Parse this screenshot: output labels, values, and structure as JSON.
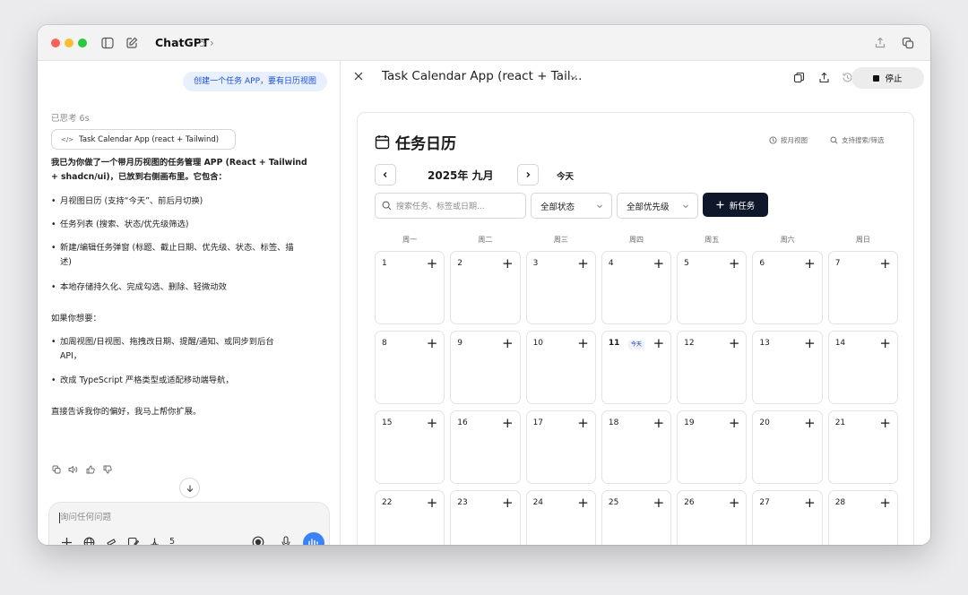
{
  "app": {
    "title": "ChatGPT",
    "version": "5"
  },
  "chat": {
    "user_message": "创建一个任务 APP，要有日历视图",
    "thought_label": "已思考 6s",
    "file_chip": {
      "icon": "</>",
      "name": "Task Calendar App (react + Tailwind)"
    },
    "intro_line1": "我已为你做了一个带月历视图的任务管理 APP (React + Tailwind",
    "intro_line2": "+ shadcn/ui)，已放到右侧画布里。它包含：",
    "features": [
      "月视图日历 (支持“今天”、前后月切换)",
      "任务列表 (搜索、状态/优先级筛选)",
      "新建/编辑任务弹窗 (标题、截止日期、优先级、状态、标签、描",
      "述)",
      "本地存储持久化、完成勾选、删除、轻微动效"
    ],
    "followup_label": "如果你想要：",
    "options": [
      "加周视图/日视图、拖拽改日期、提醒/通知、或同步到后台",
      "API，",
      "改成 TypeScript 严格类型或适配移动端导航，"
    ],
    "closing": "直接告诉我你的偏好，我马上帮你扩展。",
    "composer_placeholder": "询问任何问题",
    "composer_count": "5"
  },
  "canvas": {
    "title": "Task Calendar App (react + Tail...",
    "stop_label": "停止",
    "calendar": {
      "title": "任务日历",
      "hint_month_view": "按月视图",
      "hint_search": "支持搜索/筛选",
      "month_label": "2025年 九月",
      "today_button": "今天",
      "search_placeholder": "搜索任务、标签或日期...",
      "status_filter": "全部状态",
      "priority_filter": "全部优先级",
      "new_task_button": "新任务",
      "weekdays": [
        "周一",
        "周二",
        "周三",
        "周四",
        "周五",
        "周六",
        "周日"
      ],
      "days": [
        "1",
        "2",
        "3",
        "4",
        "5",
        "6",
        "7",
        "8",
        "9",
        "10",
        "11",
        "12",
        "13",
        "14",
        "15",
        "16",
        "17",
        "18",
        "19",
        "20",
        "21",
        "22",
        "23",
        "24",
        "25",
        "26",
        "27",
        "28"
      ],
      "today_day": "11",
      "today_badge": "今天",
      "add_symbol": "+"
    }
  },
  "colors": {
    "accent": "#3b82f6",
    "primary_button": "#0f172a",
    "user_bubble_bg": "#e8f0fd"
  }
}
